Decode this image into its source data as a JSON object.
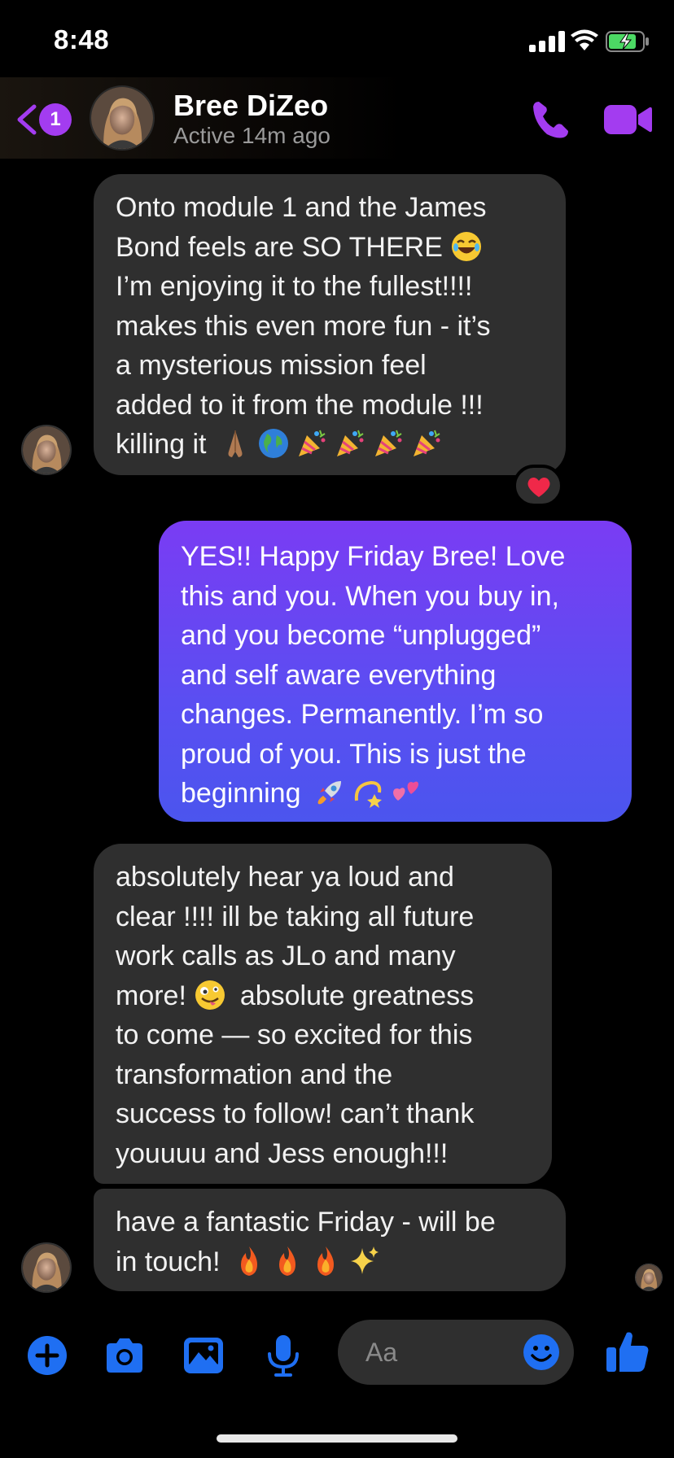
{
  "status_bar": {
    "time": "8:48"
  },
  "header": {
    "back_count": "1",
    "contact_name": "Bree DiZeo",
    "contact_status": "Active 14m ago"
  },
  "messages": [
    {
      "direction": "incoming",
      "text": "Onto module 1 and the James Bond feels are SO THERE 😂 I’m enjoying it to the fullest!!!! makes this even more fun - it’s a mysterious mission feel added to it from the module !!! killing it 🙏🏽🌍🎉🎉🎉🎉",
      "lines": [
        "Onto module 1 and the James",
        "Bond feels are SO THERE",
        "I’m enjoying it to the fullest!!!!",
        "makes this even more fun - it’s",
        "a mysterious mission feel",
        "added to it from the module !!!",
        "killing it"
      ],
      "reaction": "heart"
    },
    {
      "direction": "outgoing",
      "text": "YES!! Happy Friday Bree! Love this and you. When you buy in, and you become “unplugged” and self aware everything changes. Permanently. I’m so proud of you. This is just the beginning 🚀💫💕",
      "lines": [
        "YES!! Happy Friday Bree! Love",
        "this and you. When you buy in,",
        "and you become “unplugged”",
        "and self aware everything",
        "changes. Permanently. I’m so",
        "proud of you. This is just the",
        "beginning"
      ]
    },
    {
      "direction": "incoming",
      "text": "absolutely hear ya loud and clear !!!! ill be taking all future work calls as JLo and many more! 🤪 absolute greatness to come — so excited for this transformation and the success to follow! can’t thank youuuu and Jess enough!!!",
      "lines": [
        "absolutely hear ya loud and",
        "clear !!!! ill be taking all future",
        "work calls as JLo and many",
        "more!",
        "absolute greatness",
        "to come — so excited for this",
        "transformation and the",
        "success to follow! can’t thank",
        "youuuu and Jess enough!!!"
      ]
    },
    {
      "direction": "incoming",
      "text": "have a fantastic Friday - will be in touch! 🔥🔥🔥✨",
      "lines": [
        "have a fantastic Friday - will be",
        "in touch!"
      ]
    }
  ],
  "composer": {
    "placeholder": "Aa"
  },
  "colors": {
    "accent": "#a33cf0",
    "incoming_bubble": "#2f2f2f",
    "outgoing_gradient_top": "#7a3cf3",
    "outgoing_gradient_bottom": "#4b55ee",
    "icon_blue": "#1f6ff2"
  },
  "icons": [
    "back-chevron-icon",
    "phone-icon",
    "video-camera-icon",
    "plus-icon",
    "camera-icon",
    "gallery-icon",
    "microphone-icon",
    "smiley-icon",
    "thumbs-up-icon",
    "heart-icon"
  ]
}
